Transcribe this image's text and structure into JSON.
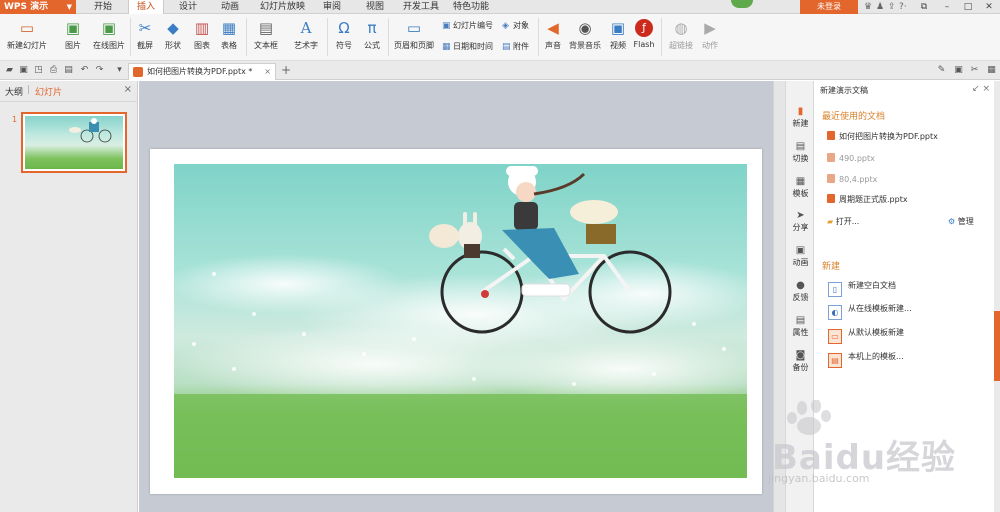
{
  "app": {
    "name": "WPS 演示",
    "login": "未登录",
    "badge": ""
  },
  "menu_tabs": [
    "开始",
    "插入",
    "设计",
    "动画",
    "幻灯片放映",
    "审阅",
    "视图",
    "开发工具",
    "特色功能"
  ],
  "active_menu_tab": "插入",
  "ribbon": {
    "new_slide": "新建幻灯片",
    "picture": "图片",
    "online_picture": "在线图片",
    "screenshot": "截屏",
    "shape": "形状",
    "chart": "图表",
    "table": "表格",
    "textbox": "文本框",
    "wordart": "艺术字",
    "symbol": "符号",
    "formula": "公式",
    "header_footer": "页眉和页脚",
    "slide_number": "幻灯片编号",
    "object": "对象",
    "date_time": "日期和时间",
    "attachment": "附件",
    "sound": "声音",
    "bg_music": "背景音乐",
    "video": "视频",
    "flash": "Flash",
    "hyperlink": "超链接",
    "action": "动作"
  },
  "doc_tab": {
    "title": "如何把图片转换为PDF.pptx",
    "modified_mark": "*"
  },
  "left_panel": {
    "tab_outline": "大纲",
    "tab_slides": "幻灯片",
    "slide_number": "1"
  },
  "side_strip": [
    "新建",
    "切换",
    "模板",
    "分享",
    "动画",
    "反馈",
    "属性",
    "备份"
  ],
  "task_pane": {
    "title": "新建演示文稿",
    "recent_heading": "最近使用的文档",
    "recent_files": [
      "如何把图片转换为PDF.pptx",
      "490.pptx",
      "80,4.pptx",
      "周期题正式版.pptx"
    ],
    "open_label": "打开...",
    "manage_label": "管理",
    "new_heading": "新建",
    "new_items": [
      "新建空白文档",
      "从在线模板新建...",
      "从默认模板新建",
      "本机上的模板..."
    ]
  },
  "watermark": {
    "brand": "Baidu经验",
    "url": "jingyan.baidu.com"
  },
  "colors": {
    "accent": "#e3662c",
    "canvas_bg": "#c6cad2",
    "grass": "#6bb74b",
    "sky": "#86d3cb"
  }
}
